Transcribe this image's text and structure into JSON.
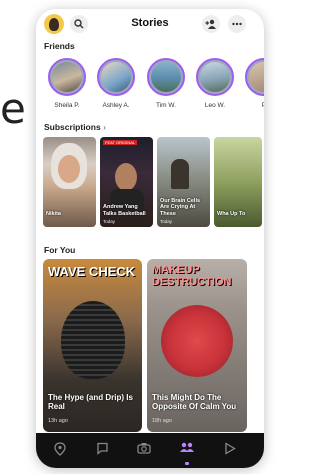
{
  "background_text": "e",
  "header": {
    "title": "Stories"
  },
  "sections": {
    "friends": "Friends",
    "subscriptions": "Subscriptions",
    "subscriptions_arrow": "›",
    "for_you": "For You"
  },
  "friends": [
    {
      "name": "Sheila P."
    },
    {
      "name": "Ashley A."
    },
    {
      "name": "Tim W."
    },
    {
      "name": "Leo W."
    },
    {
      "name": "P"
    }
  ],
  "subscriptions": [
    {
      "caption": "Nikita",
      "time": "",
      "badge": ""
    },
    {
      "caption": "Andrew Yang Talks Basketball",
      "time": "Today",
      "badge": "FEAT ORIGINAL"
    },
    {
      "caption": "Our Brain Cells Are Crying At These",
      "time": "Today",
      "badge": ""
    },
    {
      "caption": "Wha Up To",
      "time": "",
      "badge": ""
    }
  ],
  "for_you": [
    {
      "headline": "WAVE CHECK",
      "caption": "The Hype (and Drip) Is Real",
      "time": "13h ago"
    },
    {
      "headline": "MAKEUP DESTRUCTION",
      "caption": "This Might Do The Opposite Of Calm You",
      "time": "18h ago"
    }
  ],
  "icons": {
    "search": "search-icon",
    "add_friend": "add-friend-icon",
    "more": "more-icon",
    "map": "map-icon",
    "chat": "chat-icon",
    "camera": "camera-icon",
    "stories": "stories-icon",
    "discover": "discover-icon"
  },
  "colors": {
    "accent": "#a05cf0",
    "nav_bg": "#111111",
    "active": "#b983ff"
  }
}
